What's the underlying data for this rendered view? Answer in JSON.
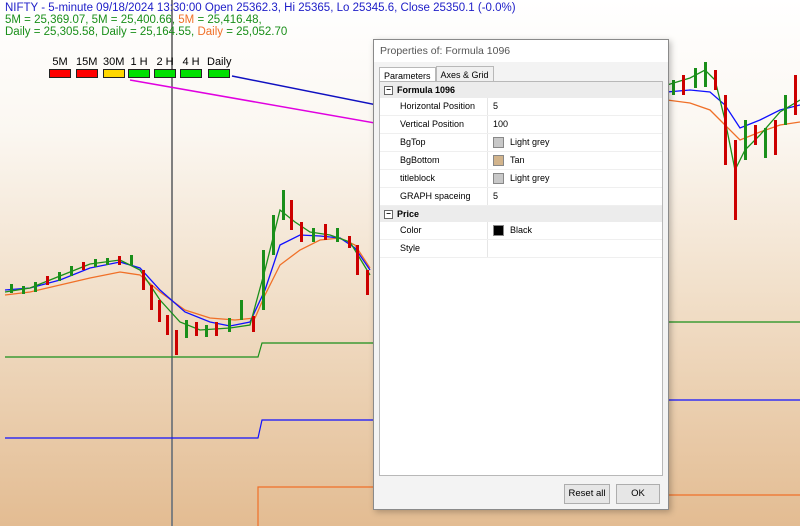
{
  "header": {
    "line1": "NIFTY - 5-minute 09/18/2024 13:30:00 Open 25362.3, Hi 25365, Lo 25345.6, Close 25350.1 (-0.0%)",
    "line2_green": "5M = 25,369.07, 5M = 25,400.66, ",
    "line2_orange": "5M",
    "line2_rest": " = 25,416.48,",
    "line3_green": "Daily = 25,305.58, Daily = 25,164.55, ",
    "line3_orange": "Daily",
    "line3_rest": " = 25,052.70"
  },
  "timeframes": [
    {
      "label": "5M",
      "color": "#ff0000"
    },
    {
      "label": "15M",
      "color": "#ff0000"
    },
    {
      "label": "30M",
      "color": "#ffd700"
    },
    {
      "label": "1 H",
      "color": "#00e000"
    },
    {
      "label": "2 H",
      "color": "#00e000"
    },
    {
      "label": "4 H",
      "color": "#00e000"
    },
    {
      "label": "Daily",
      "color": "#00e000"
    }
  ],
  "dialog": {
    "title": "Properties of: Formula 1096",
    "tabs": [
      "Parameters",
      "Axes & Grid"
    ],
    "sections": [
      {
        "title": "Formula 1096",
        "rows": [
          {
            "key": "Horizontal Position",
            "value": "5"
          },
          {
            "key": "Vertical Position",
            "value": "100"
          },
          {
            "key": "BgTop",
            "value": "Light grey",
            "swatch": "#c8c8c8"
          },
          {
            "key": "BgBottom",
            "value": "Tan",
            "swatch": "#d2b48c"
          },
          {
            "key": "titleblock",
            "value": "Light grey",
            "swatch": "#c8c8c8"
          },
          {
            "key": "GRAPH spaceing",
            "value": "5"
          }
        ]
      },
      {
        "title": "Price",
        "rows": [
          {
            "key": "Color",
            "value": "Black",
            "swatch": "#000000"
          },
          {
            "key": "Style",
            "value": ""
          }
        ]
      }
    ],
    "buttons": {
      "reset": "Reset all",
      "ok": "OK"
    }
  },
  "colors": {
    "blue_arrow": "#1010c0",
    "magenta_arrow": "#e000e0",
    "green_line": "#1a8f1a",
    "blue_line": "#1010ff",
    "orange_line": "#f07028"
  }
}
